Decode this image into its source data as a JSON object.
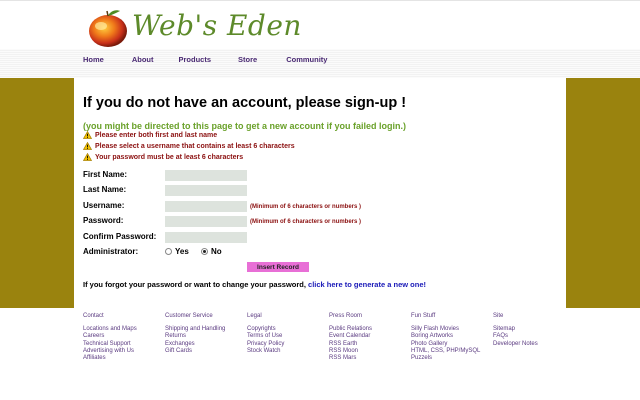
{
  "site": {
    "brand": "Web's Eden"
  },
  "nav": [
    {
      "label": "Home"
    },
    {
      "label": "About"
    },
    {
      "label": "Products"
    },
    {
      "label": "Store"
    },
    {
      "label": "Community"
    }
  ],
  "signup": {
    "title": "If you do not have an account, please sign-up !",
    "subtitle": "(you might be directed to this page to get a new account if you failed login.)",
    "warnings": [
      "Please enter both first and last name",
      "Please select a username that contains at least 6 characters",
      "Your password must be at least 6 characters"
    ],
    "fields": {
      "first_name": {
        "label": "First Name:",
        "value": ""
      },
      "last_name": {
        "label": "Last Name:",
        "value": ""
      },
      "username": {
        "label": "Username:",
        "value": "",
        "hint": "(Minimum of 6 characters or numbers )"
      },
      "password": {
        "label": "Password:",
        "value": "",
        "hint": "(Minimum of 6 characters or numbers )"
      },
      "confirm_password": {
        "label": "Confirm Password:",
        "value": ""
      },
      "administrator": {
        "label": "Administrator:",
        "options": [
          "Yes",
          "No"
        ],
        "selected": "No"
      }
    },
    "submit_label": "Insert Record",
    "forgot_text": "If you forgot your password or want to change your password, ",
    "forgot_link": "click here to generate a new one!"
  },
  "footer": {
    "columns": [
      {
        "heading": "Contact",
        "links": [
          "Locations and Maps",
          "Careers",
          "Technical Support",
          "Advertising with Us",
          "Affiliates"
        ]
      },
      {
        "heading": "Customer Service",
        "links": [
          "Shipping and Handling",
          "Returns",
          "Exchanges",
          "Gift Cards"
        ]
      },
      {
        "heading": "Legal",
        "links": [
          "Copyrights",
          "Terms of Use",
          "Privacy Policy",
          "Stock Watch"
        ]
      },
      {
        "heading": "Press Room",
        "links": [
          "Public Relations",
          "Event Calendar",
          "RSS Earth",
          "RSS Moon",
          "RSS Mars"
        ]
      },
      {
        "heading": "Fun Stuff",
        "links": [
          "Silly Flash Movies",
          "Boring Artworks",
          "Photo Gallery",
          "HTML, CSS, PHP/MySQL",
          "Puzzels"
        ]
      },
      {
        "heading": "Site",
        "links": [
          "Sitemap",
          "FAQs",
          "Developer Notes"
        ]
      }
    ]
  },
  "colors": {
    "olive_band": "#9a830e",
    "nav_text": "#4a2a73",
    "warning_text": "#8b1010",
    "subtitle_green": "#6aa12a",
    "button_pink": "#e86fd6",
    "link_blue": "#1a1ab8"
  },
  "icons": {
    "warning": "warning-triangle-icon",
    "logo": "apple-logo-icon"
  }
}
